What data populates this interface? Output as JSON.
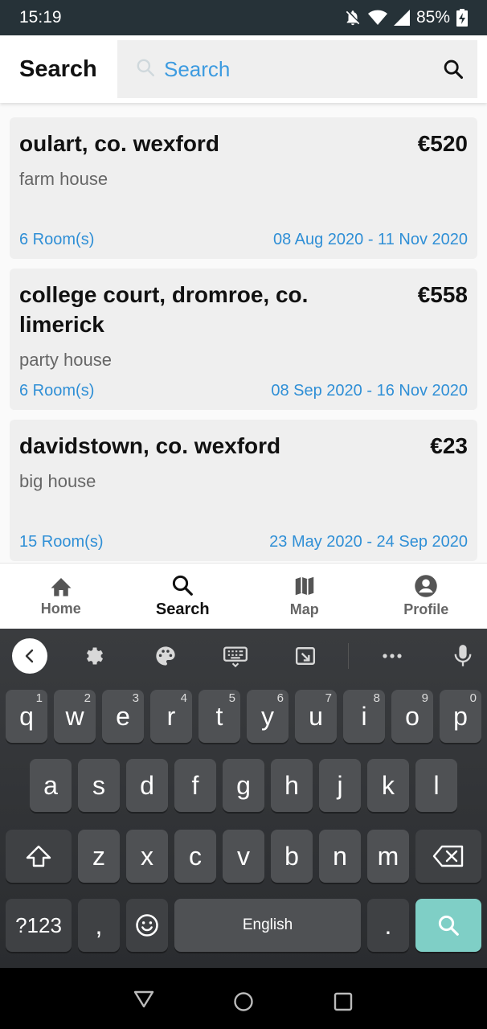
{
  "status_bar": {
    "time": "15:19",
    "battery": "85%",
    "icons": [
      "notifications-off-icon",
      "wifi-icon",
      "signal-icon",
      "battery-charging-icon"
    ]
  },
  "header": {
    "title": "Search",
    "search_placeholder": "Search"
  },
  "listings": [
    {
      "location": "oulart, co. wexford",
      "price": "€520",
      "type": "farm house",
      "rooms": "6 Room(s)",
      "dates": "08 Aug 2020 - 11 Nov 2020"
    },
    {
      "location": "college court, dromroe, co. limerick",
      "price": "€558",
      "type": "party house",
      "rooms": "6 Room(s)",
      "dates": "08 Sep 2020 - 16 Nov 2020"
    },
    {
      "location": "davidstown, co. wexford",
      "price": "€23",
      "type": "big house",
      "rooms": "15 Room(s)",
      "dates": "23 May 2020 - 24 Sep 2020"
    }
  ],
  "bottom_nav": {
    "items": [
      {
        "label": "Home",
        "icon": "home-icon"
      },
      {
        "label": "Search",
        "icon": "search-icon",
        "active": true
      },
      {
        "label": "Map",
        "icon": "map-icon"
      },
      {
        "label": "Profile",
        "icon": "profile-icon"
      }
    ]
  },
  "keyboard": {
    "row1": [
      {
        "key": "q",
        "hint": "1"
      },
      {
        "key": "w",
        "hint": "2"
      },
      {
        "key": "e",
        "hint": "3"
      },
      {
        "key": "r",
        "hint": "4"
      },
      {
        "key": "t",
        "hint": "5"
      },
      {
        "key": "y",
        "hint": "6"
      },
      {
        "key": "u",
        "hint": "7"
      },
      {
        "key": "i",
        "hint": "8"
      },
      {
        "key": "o",
        "hint": "9"
      },
      {
        "key": "p",
        "hint": "0"
      }
    ],
    "row2": [
      "a",
      "s",
      "d",
      "f",
      "g",
      "h",
      "j",
      "k",
      "l"
    ],
    "row3": [
      "z",
      "x",
      "c",
      "v",
      "b",
      "n",
      "m"
    ],
    "symbols_label": "?123",
    "comma": ",",
    "period": ".",
    "space_label": "English",
    "action_color": "#7fcfc6"
  }
}
